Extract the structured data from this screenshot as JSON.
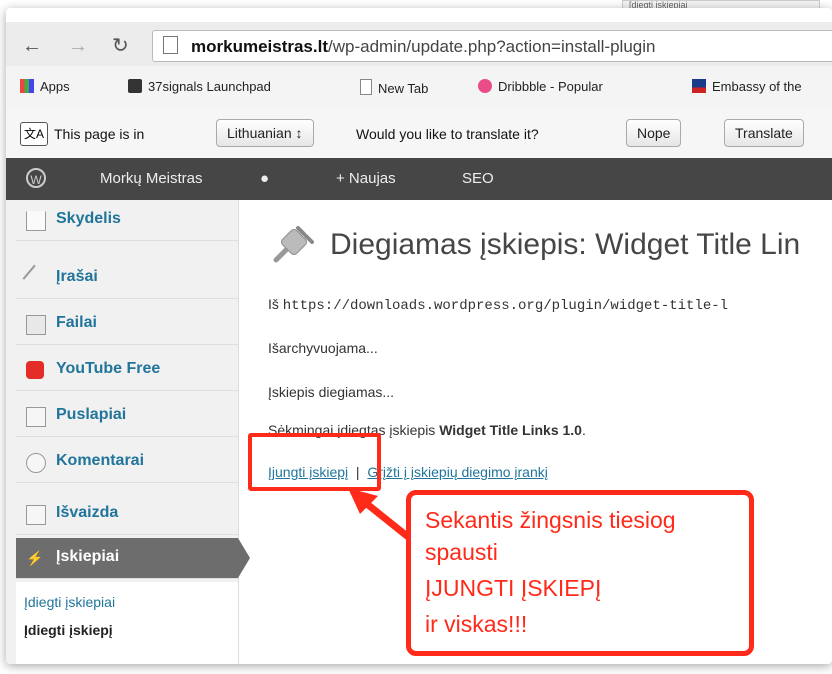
{
  "top_tooltip": "[diegti jskiepiai",
  "browser": {
    "url_host": "morkumeistras.lt",
    "url_path": "/wp-admin/update.php?action=install-plugin"
  },
  "bookmarks": [
    "Apps",
    "37signals Launchpad",
    "New Tab",
    "Dribbble - Popular",
    "Embassy of the"
  ],
  "translate": {
    "prefix": "This page is in",
    "language": "Lithuanian",
    "question": "Would you like to translate it?",
    "nope": "Nope",
    "translate": "Translate"
  },
  "adminbar": {
    "site": "Morkų Meistras",
    "new": "+ Naujas",
    "seo": "SEO"
  },
  "sidebar": {
    "items": [
      {
        "label": "Skydelis",
        "icon": "home-icon"
      },
      {
        "label": "Įrašai",
        "icon": "pin-icon"
      },
      {
        "label": "Failai",
        "icon": "media-icon"
      },
      {
        "label": "YouTube Free",
        "icon": "youtube-icon"
      },
      {
        "label": "Puslapiai",
        "icon": "pages-icon"
      },
      {
        "label": "Komentarai",
        "icon": "comments-icon"
      },
      {
        "label": "Išvaizda",
        "icon": "appearance-icon"
      },
      {
        "label": "Įskiepiai",
        "icon": "plugins-icon"
      }
    ],
    "submenu": [
      "Įdiegti įskiepiai",
      "Įdiegti įskiepį"
    ]
  },
  "content": {
    "title": "Diegiamas įskiepis: Widget Title Lin",
    "line1_prefix": "Iš",
    "line1_url": "https://downloads.wordpress.org/plugin/widget-title-l",
    "line2": "Išarchyvuojama...",
    "line3": "Įskiepis diegiamas...",
    "line4_prefix": "Sėkmingai įdiegtas įskiepis",
    "line4_bold": "Widget Title Links 1.0",
    "line4_suffix": ".",
    "activate_link": "Įjungti įskiepį",
    "return_link": "Grįžti į įskiepių diegimo įrankį"
  },
  "callout": {
    "lines": [
      "Sekantis žingsnis tiesiog",
      "spausti",
      "ĮJUNGTI ĮSKIEPĮ",
      "ir viskas!!!"
    ]
  },
  "colors": {
    "annotation": "#ff2a1a",
    "link": "#21759b",
    "adminbar": "#464646"
  }
}
